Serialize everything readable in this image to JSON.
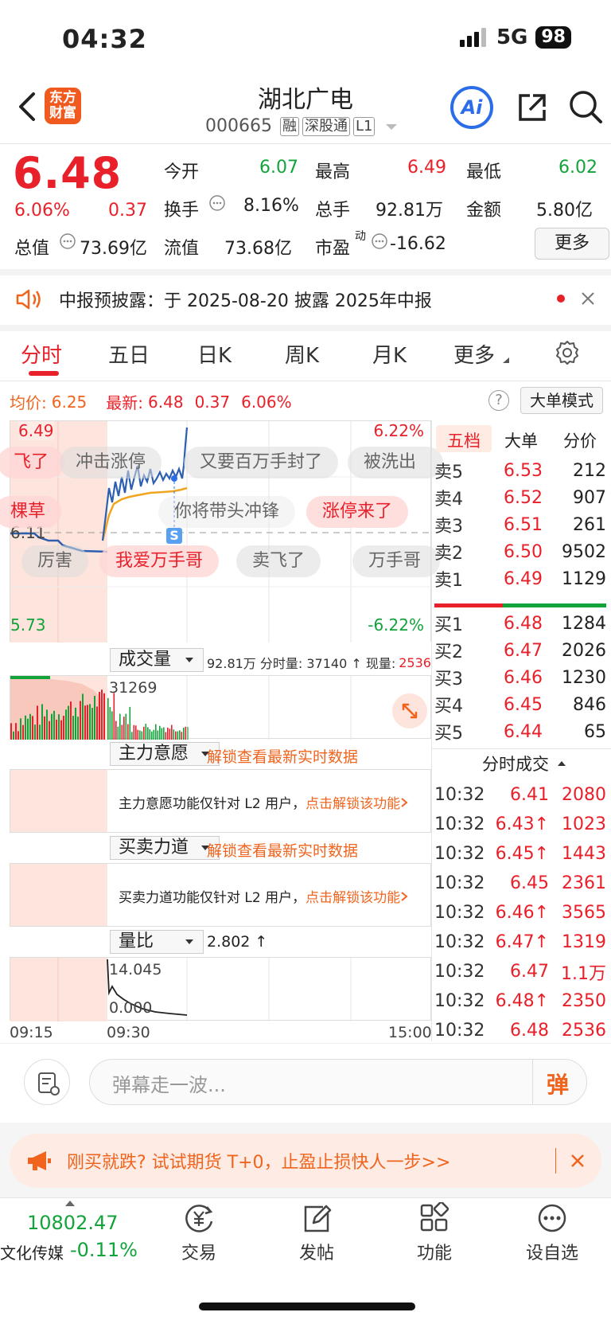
{
  "status": {
    "time": "04:32",
    "network": "5G",
    "battery": "98"
  },
  "header": {
    "title": "湖北广电",
    "code": "000665",
    "tags": [
      "融",
      "深股通",
      "L1"
    ],
    "logo": "东方\n财富",
    "ai_label": "Ai"
  },
  "quote": {
    "price": "6.48",
    "change_pct": "6.06%",
    "change": "0.37",
    "open_label": "今开",
    "open": "6.07",
    "high_label": "最高",
    "high": "6.49",
    "low_label": "最低",
    "low": "6.02",
    "turnover_label": "换手",
    "turnover": "8.16%",
    "volume_label": "总手",
    "volume": "92.81万",
    "amount_label": "金额",
    "amount": "5.80亿",
    "mcap_label": "总值",
    "mcap": "73.69亿",
    "float_label": "流值",
    "float": "73.68亿",
    "pe_label": "市盈",
    "pe_sup": "动",
    "pe": "-16.62",
    "more": "更多"
  },
  "notice": {
    "text": "中报预披露：于 2025-08-20 披露 2025年中报"
  },
  "tabs": [
    "分时",
    "五日",
    "日K",
    "周K",
    "月K",
    "更多"
  ],
  "chart_info": {
    "avg_label": "均价:",
    "avg": "6.25",
    "latest_label": "最新:",
    "latest": "6.48",
    "chg": "0.37",
    "pct": "6.06%",
    "mode_btn": "大单模式",
    "help": "?"
  },
  "chart": {
    "y_top": "6.49",
    "y_mid": "6.11",
    "y_bottom": "5.73",
    "pct_top": "6.22%",
    "pct_bottom": "-6.22%",
    "marker": "S",
    "danmu": [
      "飞了",
      "冲击涨停",
      "又要百万手封了",
      "被洗出",
      "棵草",
      "你将带头冲锋",
      "涨停来了",
      "厉害",
      "我爱万手哥",
      "卖飞了",
      "万手哥"
    ]
  },
  "volume_panel": {
    "label": "成交量",
    "info": "92.81万 分时量: 37140 ↑ 现量:",
    "now": "2536",
    "peak": "31269"
  },
  "main_force": {
    "label": "主力意愿",
    "unlock": "解锁查看最新实时数据",
    "msg": "主力意愿功能仅针对 L2 用户，",
    "link": "点击解锁该功能"
  },
  "buy_sell": {
    "label": "买卖力道",
    "unlock": "解锁查看最新实时数据",
    "msg": "买卖力道功能仅针对 L2 用户，",
    "link": "点击解锁该功能"
  },
  "ratio_panel": {
    "label": "量比",
    "value": "2.802 ↑",
    "top": "14.045",
    "bottom": "0.000"
  },
  "time_axis": {
    "start": "09:15",
    "open": "09:30",
    "end": "15:00"
  },
  "orderbook": {
    "tabs": [
      "五档",
      "大单",
      "分价"
    ],
    "asks": [
      {
        "label": "卖5",
        "price": "6.53",
        "vol": "212"
      },
      {
        "label": "卖4",
        "price": "6.52",
        "vol": "907"
      },
      {
        "label": "卖3",
        "price": "6.51",
        "vol": "261"
      },
      {
        "label": "卖2",
        "price": "6.50",
        "vol": "9502"
      },
      {
        "label": "卖1",
        "price": "6.49",
        "vol": "1129"
      }
    ],
    "bids": [
      {
        "label": "买1",
        "price": "6.48",
        "vol": "1284"
      },
      {
        "label": "买2",
        "price": "6.47",
        "vol": "2026"
      },
      {
        "label": "买3",
        "price": "6.46",
        "vol": "1230"
      },
      {
        "label": "买4",
        "price": "6.45",
        "vol": "846"
      },
      {
        "label": "买5",
        "price": "6.44",
        "vol": "65"
      }
    ]
  },
  "trades_header": "分时成交",
  "trades": [
    {
      "time": "10:32",
      "price": "6.41",
      "vol": "2080"
    },
    {
      "time": "10:32",
      "price": "6.43↑",
      "vol": "1023"
    },
    {
      "time": "10:32",
      "price": "6.45↑",
      "vol": "1443"
    },
    {
      "time": "10:32",
      "price": "6.45",
      "vol": "2361"
    },
    {
      "time": "10:32",
      "price": "6.46↑",
      "vol": "3565"
    },
    {
      "time": "10:32",
      "price": "6.47↑",
      "vol": "1319"
    },
    {
      "time": "10:32",
      "price": "6.47",
      "vol": "1.1万"
    },
    {
      "time": "10:32",
      "price": "6.48↑",
      "vol": "2350"
    },
    {
      "time": "10:32",
      "price": "6.48",
      "vol": "2536"
    }
  ],
  "danmu_input": {
    "placeholder": "弹幕走一波...",
    "send": "弹"
  },
  "promo": {
    "text": "刚买就跌? 试试期货 T+0，止盈止损快人一步>>"
  },
  "bottom_nav": {
    "index_value": "10802.47",
    "index_name": "文化传媒",
    "index_pct": "-0.11%",
    "items": [
      "交易",
      "发帖",
      "功能",
      "设自选"
    ]
  },
  "colors": {
    "up": "#e8202a",
    "down": "#12a33b",
    "accent": "#f0641e",
    "link": "#2b6de8"
  }
}
